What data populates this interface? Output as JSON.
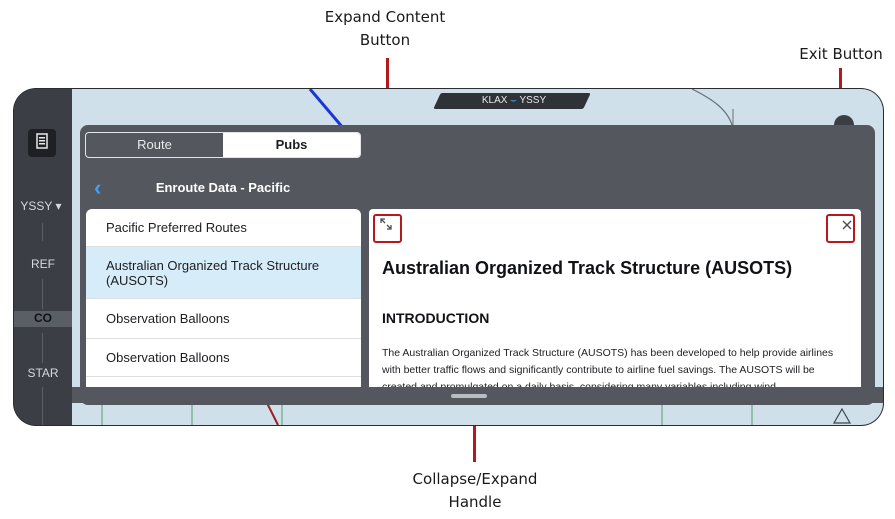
{
  "callouts": {
    "expand": "Expand Content\nButton",
    "exit": "Exit Button",
    "handle": "Collapse/Expand\nHandle"
  },
  "rail": {
    "icon": "document-list-icon",
    "destination": "YSSY",
    "items": [
      "REF",
      "CO",
      "STAR"
    ]
  },
  "map_header": {
    "from": "KLAX",
    "to": "YSSY"
  },
  "tabs": {
    "route": "Route",
    "pubs": "Pubs",
    "selected": "Pubs"
  },
  "nav": {
    "title": "Enroute Data - Pacific",
    "back_icon": "chevron-left-icon"
  },
  "list": {
    "items": [
      "Pacific Preferred Routes",
      "Australian Organized Track Structure (AUSOTS)",
      "Observation Balloons",
      "Observation Balloons"
    ],
    "selected_index": 1
  },
  "content": {
    "title": "Australian Organized Track Structure (AUSOTS)",
    "section": "INTRODUCTION",
    "body": "The Australian Organized Track Structure (AUSOTS) has been developed to help provide airlines with better traffic flows and significantly contribute to airline fuel savings. The AUSOTS will be created and promulgated on a daily basis, considering many variables including wind",
    "expand_icon": "expand-arrows-icon",
    "close_icon": "close-icon"
  },
  "colors": {
    "accent": "#3ba3ff",
    "callout_red": "#b4191c",
    "selected_row": "#d6ecf9"
  }
}
